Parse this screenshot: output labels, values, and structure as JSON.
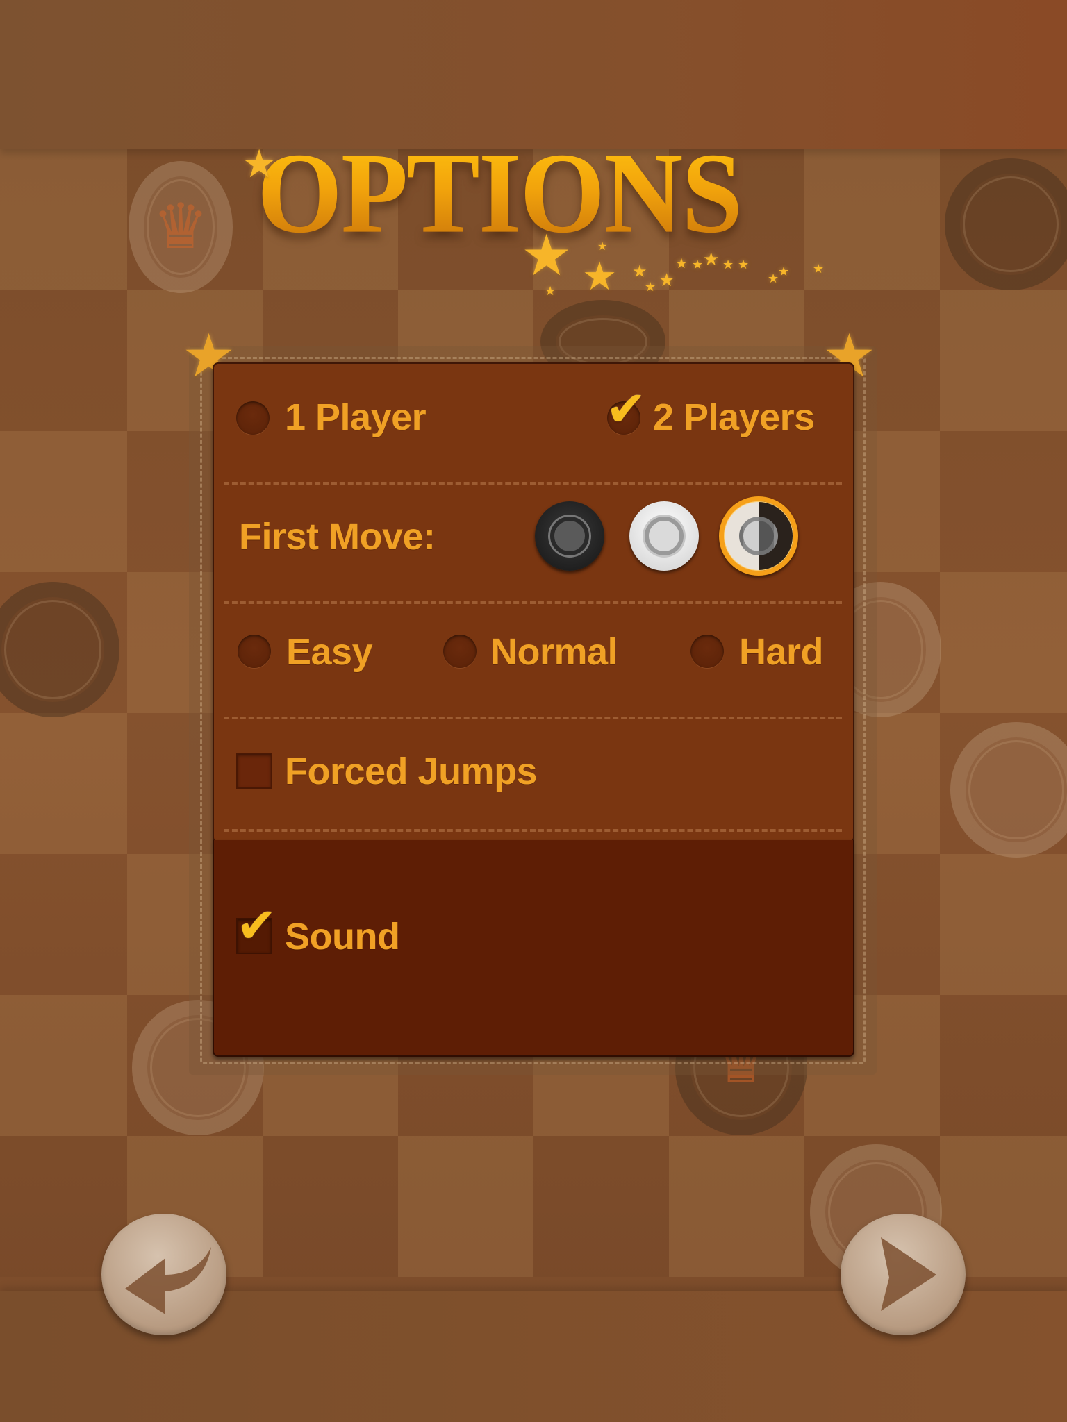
{
  "title": "OPTIONS",
  "players": {
    "options": [
      {
        "label": "1 Player",
        "selected": false
      },
      {
        "label": "2 Players",
        "selected": true
      }
    ]
  },
  "first_move": {
    "label": "First Move:",
    "options": [
      {
        "name": "black",
        "selected": false
      },
      {
        "name": "white",
        "selected": false
      },
      {
        "name": "random",
        "selected": true
      }
    ]
  },
  "difficulty": {
    "options": [
      {
        "label": "Easy",
        "selected": false
      },
      {
        "label": "Normal",
        "selected": false
      },
      {
        "label": "Hard",
        "selected": false
      }
    ]
  },
  "forced_jumps": {
    "label": "Forced Jumps",
    "checked": false
  },
  "sound": {
    "label": "Sound",
    "checked": true
  },
  "nav": {
    "back_icon": "curved-back-arrow-icon",
    "next_icon": "play-arrow-icon"
  },
  "icons": {
    "check": "✔",
    "star": "★",
    "crown": "♛"
  },
  "colors": {
    "accent": "#f0a125",
    "panel": "#7a3611",
    "panel_bottom": "#5e1e05",
    "selected_ring": "#f6a019"
  }
}
